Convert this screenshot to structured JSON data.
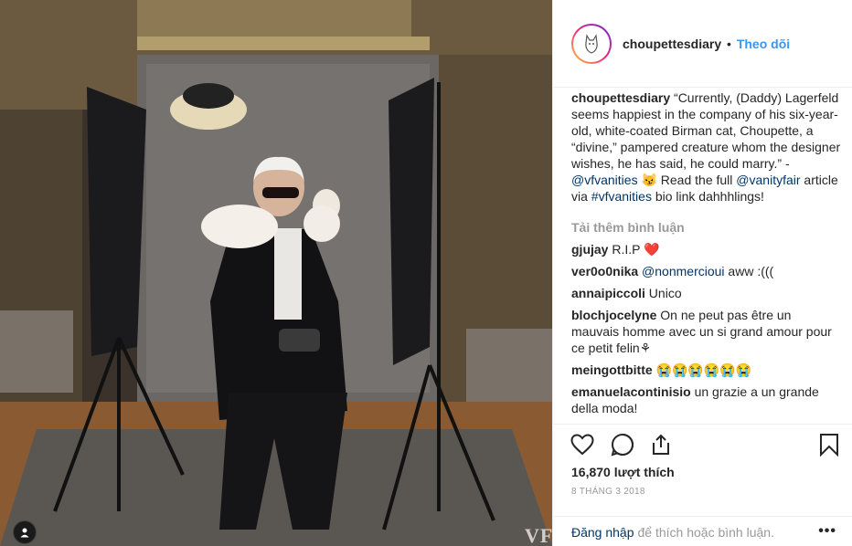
{
  "post": {
    "username": "choupettesdiary",
    "separator": "•",
    "follow_label": "Theo dõi",
    "caption": {
      "user": "choupettesdiary",
      "text_1": " “Currently, (Daddy) Lagerfeld seems happiest in the company of his six-year-old, white-coated Birman cat, Choupette, a “divine,” pampered creature whom the designer wishes, he has said, he could marry.” - ",
      "mention_1": "@vfvanities",
      "text_2": " 😼 Read the full ",
      "mention_2": "@vanityfair",
      "text_3": " article via ",
      "hashtag": "#vfvanities",
      "text_4": " bio link dahhhlings!"
    },
    "load_more_label": "Tải thêm bình luận",
    "comments": [
      {
        "user": "gjujay",
        "text": " R.I.P ❤️",
        "mention": ""
      },
      {
        "user": "ver0o0nika",
        "mention": " @nonmercioui",
        "text": " aww :((("
      },
      {
        "user": "annaipiccoli",
        "text": " Unico",
        "mention": ""
      },
      {
        "user": "blochjocelyne",
        "text": " On ne peut pas être un mauvais homme avec un si grand amour pour ce petit felin⚘",
        "mention": ""
      },
      {
        "user": "meingottbitte",
        "text": " 😭😭😭😭😭😭",
        "mention": ""
      },
      {
        "user": "emanuelacontinisio",
        "text": " un grazie a un grande della moda!",
        "mention": ""
      }
    ],
    "likes": "16,870 lượt thích",
    "date": "8 THÁNG 3 2018",
    "login_link": "Đăng nhập",
    "login_text": "để thích hoặc bình luận.",
    "more_label": "•••",
    "watermark": "VF"
  },
  "icons": {
    "like": "heart-icon",
    "comment": "comment-icon",
    "share": "share-icon",
    "save": "bookmark-icon",
    "tag": "user-tag-icon"
  }
}
